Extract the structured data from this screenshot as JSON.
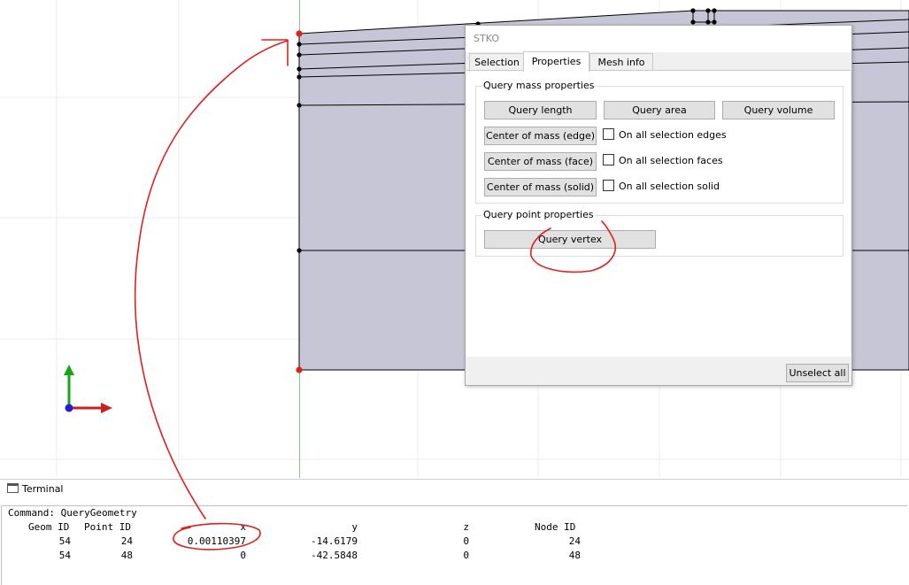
{
  "dialog": {
    "title": "STKO",
    "tabs": [
      {
        "label": "Selection",
        "active": false
      },
      {
        "label": "Properties",
        "active": true
      },
      {
        "label": "Mesh info",
        "active": false
      }
    ],
    "mass_group": {
      "title": "Query mass properties",
      "query_length": "Query length",
      "query_area": "Query area",
      "query_volume": "Query volume",
      "com_edge": "Center of mass (edge)",
      "com_face": "Center of mass (face)",
      "com_solid": "Center of mass (solid)",
      "chk_edges": "On all selection edges",
      "chk_faces": "On all selection faces",
      "chk_solid": "On all selection solid"
    },
    "point_group": {
      "title": "Query point properties",
      "query_vertex": "Query vertex"
    },
    "unselect_all": "Unselect all"
  },
  "terminal": {
    "title": "Terminal",
    "command": "Command: QueryGeometry",
    "headers": {
      "geom_id": "Geom ID",
      "point_id": "Point ID",
      "x": "x",
      "y": "y",
      "z": "z",
      "node_id": "Node ID"
    },
    "rows": [
      {
        "geom_id": "54",
        "point_id": "24",
        "x": "0.00110397",
        "y": "-14.6179",
        "z": "0",
        "node_id": "24"
      },
      {
        "geom_id": "54",
        "point_id": "48",
        "x": "0",
        "y": "-42.5848",
        "z": "0",
        "node_id": "48"
      }
    ]
  },
  "colors": {
    "geometry_fill": "#c6c6d6",
    "vertex_selected": "#e02020",
    "axis_y": "#1aa41a",
    "axis_x": "#cc2020",
    "annotation": "#e02020"
  }
}
